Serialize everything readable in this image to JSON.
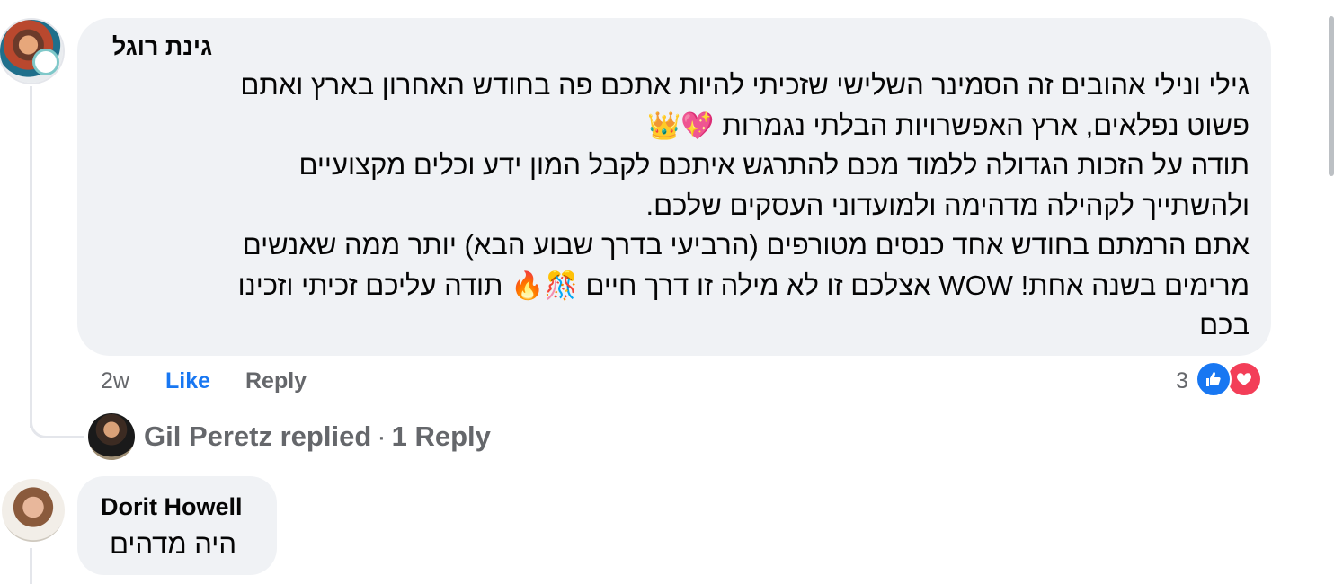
{
  "comments": [
    {
      "author": "גינת רוגל",
      "lines": [
        "גילי ונילי אהובים זה הסמינר השלישי שזכיתי להיות אתכם פה בחודש האחרון בארץ ואתם",
        "פשוט נפלאים, ארץ האפשרויות הבלתי נגמרות",
        "תודה על הזכות הגדולה ללמוד מכם להתרגש איתכם לקבל המון ידע וכלים מקצועיים",
        "ולהשתייך לקהילה מדהימה ולמועדוני העסקים שלכם.",
        "אתם הרמתם בחודש אחד כנסים מטורפים (הרביעי בדרך שבוע הבא) יותר ממה שאנשים",
        "מרימים בשנה אחת! WOW אצלכם זו לא מילה זו דרך חיים",
        "תודה עליכם זכיתי וזכינו",
        "בכם"
      ],
      "emojis": {
        "line2": "💖👑",
        "line6": "🎊🔥"
      },
      "time": "2w",
      "like_label": "Like",
      "reply_label": "Reply",
      "reaction_count": "3",
      "reaction_icons": [
        "like-icon",
        "love-icon"
      ],
      "replies_summary": {
        "replier": "Gil Peretz replied",
        "separator": "·",
        "count_label": "1 Reply"
      }
    },
    {
      "author": "Dorit Howell",
      "text": "היה מדהים"
    }
  ],
  "colors": {
    "bubble": "#f0f2f5",
    "like_blue": "#1877f2",
    "love_red": "#f33e58",
    "muted": "#65676b"
  }
}
